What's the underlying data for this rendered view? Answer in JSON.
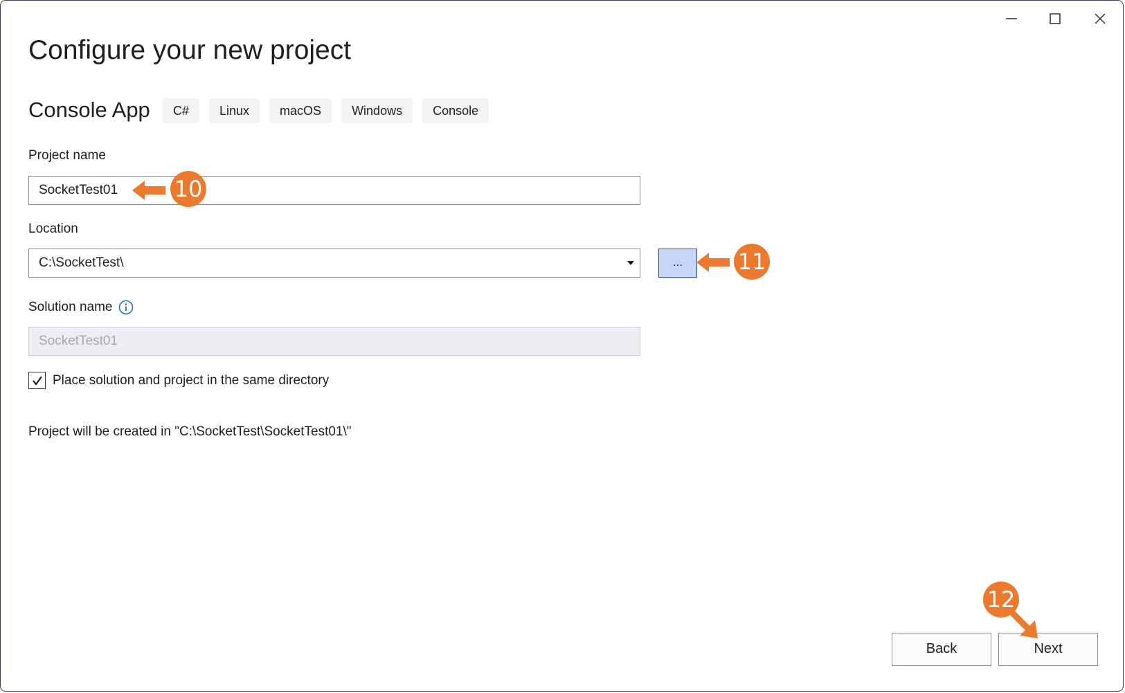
{
  "window": {
    "title": "Configure your new project",
    "controls": {
      "minimize_icon": "minimize-icon",
      "maximize_icon": "maximize-icon",
      "close_icon": "close-icon"
    }
  },
  "template": {
    "name": "Console App",
    "tags": [
      "C#",
      "Linux",
      "macOS",
      "Windows",
      "Console"
    ]
  },
  "form": {
    "project_name_label": "Project name",
    "project_name_value": "SocketTest01",
    "location_label": "Location",
    "location_value": "C:\\SocketTest\\",
    "browse_label": "...",
    "solution_name_label": "Solution name",
    "solution_name_value": "SocketTest01",
    "same_dir_label": "Place solution and project in the same directory",
    "same_dir_checked": true,
    "created_path_text": "Project will be created in \"C:\\SocketTest\\SocketTest01\\\""
  },
  "buttons": {
    "back": "Back",
    "next": "Next"
  },
  "annotations": {
    "step10": "10",
    "step11": "11",
    "step12": "12",
    "color": "#ec7a2e"
  }
}
